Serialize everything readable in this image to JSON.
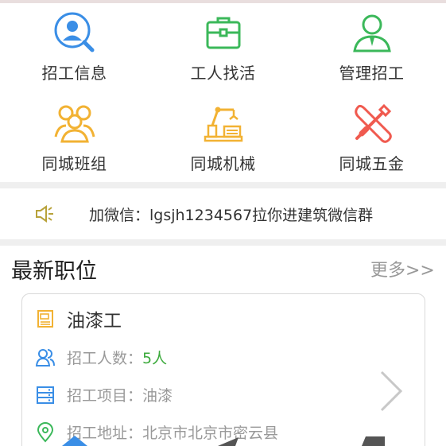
{
  "menu": {
    "items": [
      {
        "label": "招工信息",
        "icon": "recruit-search-icon"
      },
      {
        "label": "工人找活",
        "icon": "briefcase-icon"
      },
      {
        "label": "管理招工",
        "icon": "manager-icon"
      },
      {
        "label": "同城班组",
        "icon": "team-icon"
      },
      {
        "label": "同城机械",
        "icon": "machinery-icon"
      },
      {
        "label": "同城五金",
        "icon": "tools-icon"
      }
    ]
  },
  "notice": {
    "text": "加微信：lgsjh1234567拉你进建筑微信群",
    "icon": "speaker-icon"
  },
  "latest": {
    "title": "最新职位",
    "more_label": "更多>>"
  },
  "job": {
    "title": "油漆工",
    "count_key": "招工人数：",
    "count_value": "5人",
    "project_key": "招工项目：",
    "project_value": "油漆",
    "address_key": "招工地址：",
    "address_value": "北京市北京市密云县"
  },
  "colors": {
    "blue": "#3a8ee6",
    "green": "#3bb85a",
    "orange": "#f2b233",
    "red": "#f05a4f",
    "text": "#333333",
    "muted": "#999999"
  }
}
